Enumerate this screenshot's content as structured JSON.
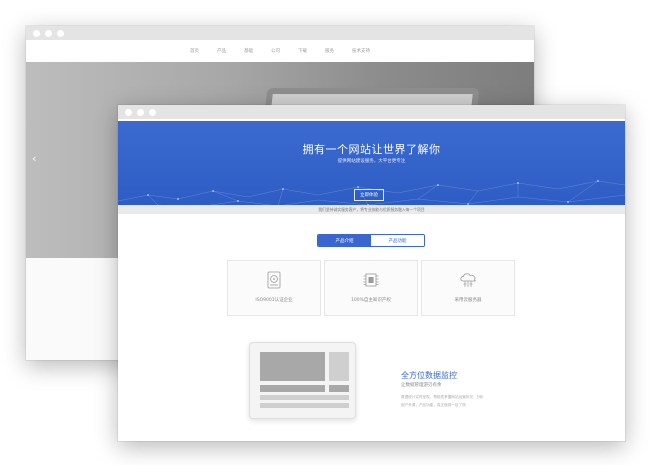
{
  "back_window": {
    "nav_items": [
      "首页",
      "产品",
      "基础",
      "公司",
      "下载",
      "服务",
      "技术支持"
    ],
    "arrow": "‹"
  },
  "front_window": {
    "hero": {
      "title": "拥有一个网站让世界了解你",
      "subtitle": "提供网站建设服务，大平台更专注",
      "button": "立即体验"
    },
    "notice": "我们坚持诚实服务客户，将专业技能与优质服务融入每一个项目",
    "tabs": [
      {
        "label": "产品介绍",
        "active": true
      },
      {
        "label": "产品功能",
        "active": false
      }
    ],
    "cards": [
      {
        "icon": "hard-disk-icon",
        "label": "ISO9001认证企业"
      },
      {
        "icon": "chip-icon",
        "label": "100%自主知识产权"
      },
      {
        "icon": "cloud-server-icon",
        "label": "采用云服务器"
      }
    ],
    "feature": {
      "title": "全方位数据监控",
      "subtitle": "让数据管理游刃有余",
      "desc_line1": "数据统计实时呈现，帮助您掌握网站运营状况，分析",
      "desc_line2": "用户来源，产品功能，真正做到一目了然"
    }
  },
  "colors": {
    "brand_blue": "#2f5fc6",
    "window_chrome": "#e4e4e4"
  }
}
